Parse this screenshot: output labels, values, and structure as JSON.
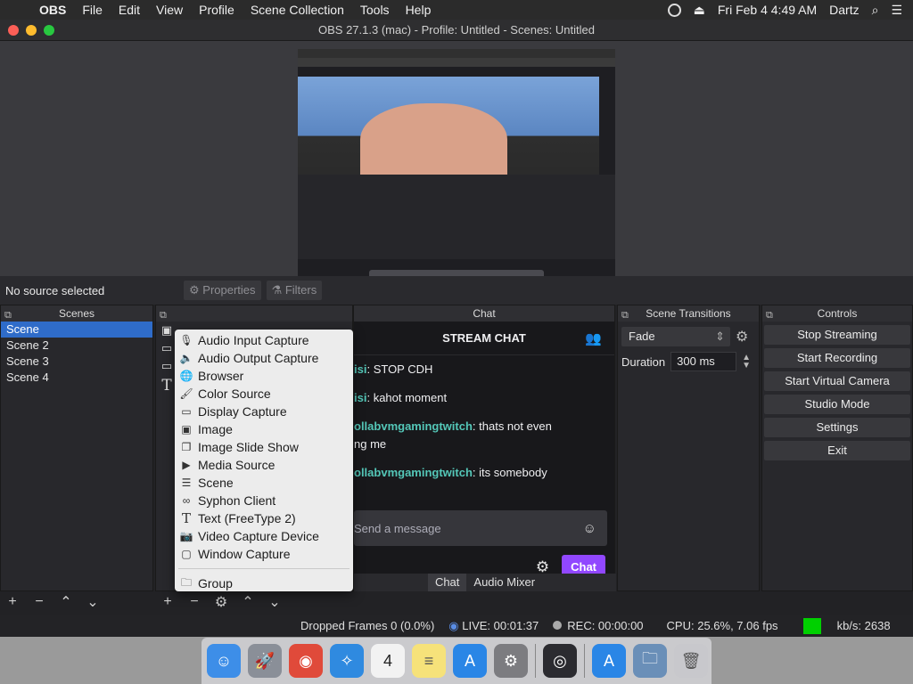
{
  "menubar": {
    "apple_icon": "apple-icon",
    "app_name": "OBS",
    "items": [
      "File",
      "Edit",
      "View",
      "Profile",
      "Scene Collection",
      "Tools",
      "Help"
    ],
    "datetime": "Fri Feb 4  4:49 AM",
    "user": "Dartz"
  },
  "window": {
    "title": "OBS 27.1.3 (mac) - Profile: Untitled - Scenes: Untitled"
  },
  "source_bar": {
    "status": "No source selected",
    "properties_label": "Properties",
    "filters_label": "Filters"
  },
  "scenes": {
    "title": "Scenes",
    "items": [
      "Scene",
      "Scene 2",
      "Scene 3",
      "Scene 4"
    ],
    "selected": "Scene"
  },
  "context_menu": {
    "items": [
      {
        "label": "Audio Input Capture",
        "icon": "microphone-icon"
      },
      {
        "label": "Audio Output Capture",
        "icon": "speaker-icon"
      },
      {
        "label": "Browser",
        "icon": "globe-icon"
      },
      {
        "label": "Color Source",
        "icon": "brush-icon"
      },
      {
        "label": "Display Capture",
        "icon": "monitor-icon"
      },
      {
        "label": "Image",
        "icon": "image-icon"
      },
      {
        "label": "Image Slide Show",
        "icon": "slideshow-icon"
      },
      {
        "label": "Media Source",
        "icon": "play-icon"
      },
      {
        "label": "Scene",
        "icon": "list-icon"
      },
      {
        "label": "Syphon Client",
        "icon": "syphon-icon"
      },
      {
        "label": "Text (FreeType 2)",
        "icon": "text-icon"
      },
      {
        "label": "Video Capture Device",
        "icon": "camera-icon"
      },
      {
        "label": "Window Capture",
        "icon": "window-icon"
      }
    ],
    "group_label": "Group"
  },
  "chat": {
    "dock_title": "Chat",
    "header": "STREAM CHAT",
    "messages": [
      {
        "user": "isi",
        "text": ": STOP CDH"
      },
      {
        "user": "isi",
        "text": ": kahot moment"
      },
      {
        "user": "ollabvmgamingtwitch",
        "text": ": thats not even",
        "cont": "ng me"
      },
      {
        "user": "ollabvmgamingtwitch",
        "text": ": its somebody"
      }
    ],
    "input_placeholder": "Send a message",
    "send_label": "Chat",
    "tabs": [
      "Chat",
      "Audio Mixer"
    ]
  },
  "transitions": {
    "title": "Scene Transitions",
    "selected": "Fade",
    "duration_label": "Duration",
    "duration_value": "300 ms"
  },
  "controls": {
    "title": "Controls",
    "buttons": [
      "Stop Streaming",
      "Start Recording",
      "Start Virtual Camera",
      "Studio Mode",
      "Settings",
      "Exit"
    ]
  },
  "status": {
    "dropped_frames": "Dropped Frames 0 (0.0%)",
    "live": "LIVE: 00:01:37",
    "rec": "REC: 00:00:00",
    "cpu": "CPU: 25.6%, 7.06 fps",
    "kbs": "kb/s: 2638",
    "indicator_color": "#00d000"
  },
  "dock_apps": [
    {
      "name": "finder-icon",
      "color": "#3d8ee8"
    },
    {
      "name": "launchpad-icon",
      "color": "#8a8f98"
    },
    {
      "name": "chrome-icon",
      "color": "#e04a3a"
    },
    {
      "name": "safari-icon",
      "color": "#2f8ae0"
    },
    {
      "name": "calendar-icon",
      "color": "#f2f2f2",
      "text": "4"
    },
    {
      "name": "notes-icon",
      "color": "#f6e27a"
    },
    {
      "name": "app-store-icon",
      "color": "#2a86e6"
    },
    {
      "name": "system-preferences-icon",
      "color": "#7c7c80"
    },
    {
      "name": "obs-icon",
      "color": "#2b2b30"
    },
    {
      "name": "app-store-icon-2",
      "color": "#2a86e6"
    },
    {
      "name": "folder-icon",
      "color": "#6a8fb8"
    },
    {
      "name": "trash-icon",
      "color": "#c8c8cc"
    }
  ]
}
